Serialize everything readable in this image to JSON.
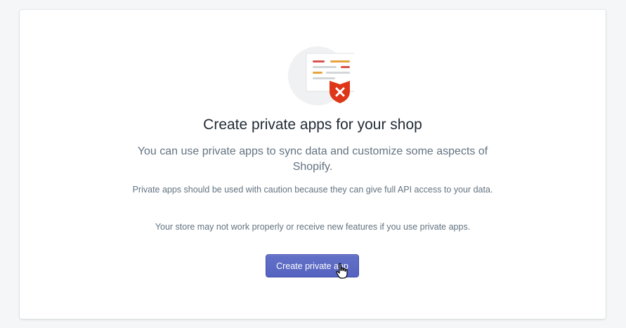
{
  "empty_state": {
    "title": "Create private apps for your shop",
    "subtitle": "You can use private apps to sync data and customize some aspects of Shopify.",
    "caution_text": "Private apps should be used with caution because they can give full API access to your data.",
    "warning_text": "Your store may not work properly or receive new features if you use private apps.",
    "primary_button_label": "Create private app"
  },
  "icons": {
    "illustration": "document-with-shield-x-icon",
    "cursor": "hand-pointer-cursor-icon"
  },
  "colors": {
    "primary_button": "#5c6ac4",
    "title_text": "#212b36",
    "body_text": "#637381",
    "shield_red": "#de3618"
  }
}
